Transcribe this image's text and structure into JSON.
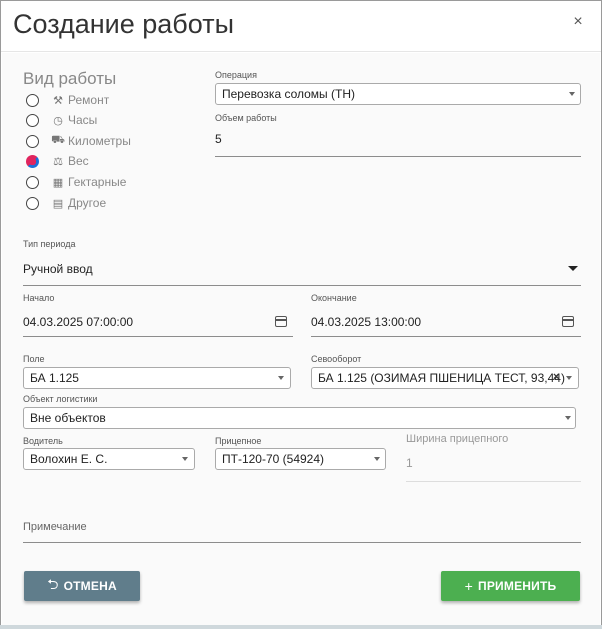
{
  "dialog": {
    "title": "Создание работы",
    "close_glyph": "×"
  },
  "work_type": {
    "title": "Вид работы",
    "options": [
      {
        "label": "Ремонт",
        "icon": "wrench-icon",
        "glyph": "🔧",
        "checked": false
      },
      {
        "label": "Часы",
        "icon": "clock-icon",
        "glyph": "◷",
        "checked": false
      },
      {
        "label": "Километры",
        "icon": "truck-icon",
        "glyph": "⛟",
        "checked": false
      },
      {
        "label": "Вес",
        "icon": "scales-icon",
        "glyph": "⚖",
        "checked": true
      },
      {
        "label": "Гектарные",
        "icon": "map-icon",
        "glyph": "▦",
        "checked": false
      },
      {
        "label": "Другое",
        "icon": "document-icon",
        "glyph": "▤",
        "checked": false
      }
    ]
  },
  "operation": {
    "label": "Операция",
    "value": "Перевозка соломы (ТН)"
  },
  "volume": {
    "label": "Объем работы",
    "value": "5"
  },
  "period_type": {
    "label": "Тип периода",
    "value": "Ручной ввод"
  },
  "start": {
    "label": "Начало",
    "value": "04.03.2025 07:00:00"
  },
  "end": {
    "label": "Окончание",
    "value": "04.03.2025 13:00:00"
  },
  "field": {
    "label": "Поле",
    "value": "БА 1.125"
  },
  "crop_rotation": {
    "label": "Севооборот",
    "value": "БА 1.125 (ОЗИМАЯ ПШЕНИЦА ТЕСТ, 93,44)",
    "clear_glyph": "×"
  },
  "logistics": {
    "label": "Объект логистики",
    "value": "Вне объектов"
  },
  "driver": {
    "label": "Водитель",
    "value": "Волохин Е. С."
  },
  "trailer": {
    "label": "Прицепное",
    "value": "ПТ-120-70 (54924)"
  },
  "trailer_width": {
    "label": "Ширина прицепного",
    "value": "1"
  },
  "note": {
    "label": "Примечание"
  },
  "buttons": {
    "cancel": "ОТМЕНА",
    "cancel_glyph": "⮌",
    "apply": "ПРИМЕНИТЬ",
    "apply_glyph": "+"
  },
  "colors": {
    "cancel_button": "#607d8b",
    "apply_button": "#4caf50",
    "radio_checked": "#e0245e"
  }
}
